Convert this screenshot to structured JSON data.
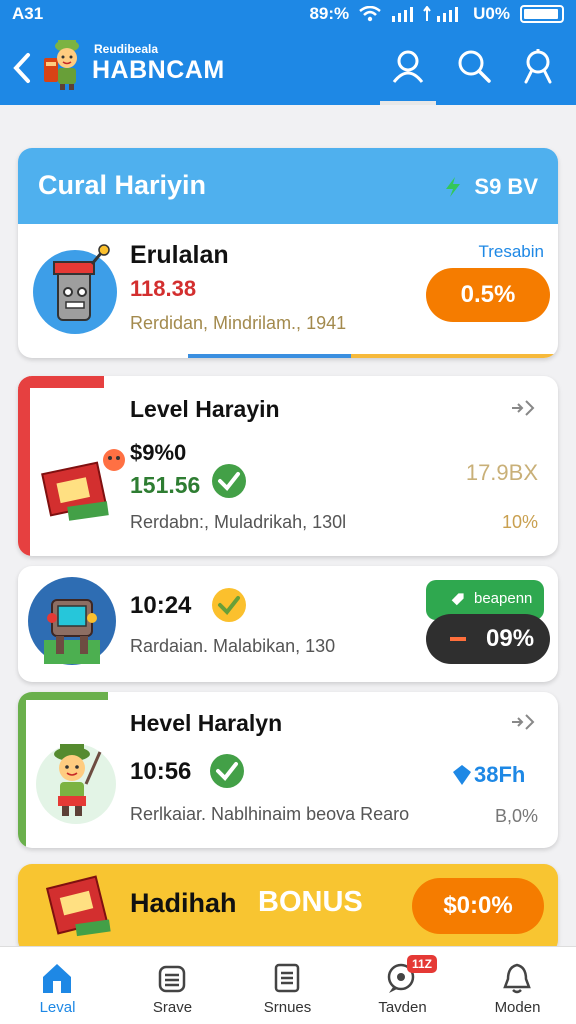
{
  "status": {
    "time": "A31",
    "left_percent": "89:%",
    "right_percent": "U0%"
  },
  "header": {
    "back_icon": "chevron-left-icon",
    "subtitle": "Reudibeala",
    "title": "HABNCAM",
    "icons": [
      "user-icon",
      "search-icon",
      "profile-icon"
    ],
    "colors": {
      "bar": "#1e88e5"
    }
  },
  "card1": {
    "title": "Cural Hariyin",
    "badge": "S9 BV",
    "name": "Erulalan",
    "value": "118.38",
    "meta": "Rerdidan, Mindrilam., 1941",
    "tag": "Tresabin",
    "pill": "0.5%",
    "pill_color": "#f57c00"
  },
  "card2": {
    "name": "Level Harayin",
    "percent": "$9%0",
    "value": "151.56",
    "meta": "Rerdabn:, Muladrikah, 130l",
    "right_value": "17.9BX",
    "right_percent": "10%",
    "accent_color": "#e64040"
  },
  "card3": {
    "value": "10:24",
    "meta": "Rardaian. Malabikan, 130",
    "tag": "beapenn",
    "pill": "09%",
    "tag_color": "#2fa84f",
    "pill_color": "#2f2f2f"
  },
  "card4": {
    "name": "Hevel Haralyn",
    "value": "10:56",
    "meta": "Rerlkaiar. Nablhinaim beova Rearo",
    "right_value": "38Fh",
    "right_percent": "B,0%",
    "accent_color": "#6ab04c"
  },
  "card5": {
    "label": "Hadihah",
    "bonus": "BONUS",
    "pill": "$0:0%",
    "pill_color": "#f57c00"
  },
  "nav": [
    {
      "label": "Leval",
      "icon": "home-icon",
      "active": true
    },
    {
      "label": "Srave",
      "icon": "wallet-icon",
      "active": false
    },
    {
      "label": "Srnues",
      "icon": "list-icon",
      "active": false
    },
    {
      "label": "Tavden",
      "icon": "chat-icon",
      "active": false,
      "badge": "11Z"
    },
    {
      "label": "Moden",
      "icon": "bell-icon",
      "active": false
    }
  ]
}
